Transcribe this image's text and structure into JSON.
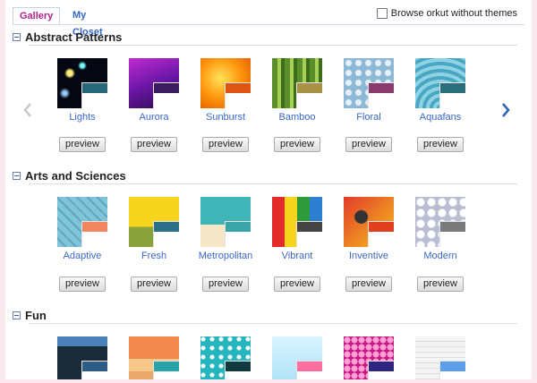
{
  "tabs": [
    {
      "label": "Gallery",
      "active": true
    },
    {
      "label": "My Closet",
      "active": false
    }
  ],
  "browse_option": {
    "label": "Browse orkut without themes",
    "checked": false
  },
  "preview_label": "preview",
  "sections": [
    {
      "title": "Abstract Patterns",
      "items": [
        {
          "name": "Lights",
          "art": "t-lights",
          "swatch": "#27677a"
        },
        {
          "name": "Aurora",
          "art": "t-aurora",
          "swatch": "#3a1d5e"
        },
        {
          "name": "Sunburst",
          "art": "t-sunburst",
          "swatch": "#dd5513"
        },
        {
          "name": "Bamboo",
          "art": "t-bamboo",
          "swatch": "#a89144"
        },
        {
          "name": "Floral",
          "art": "t-floral",
          "swatch": "#8b3a6c"
        },
        {
          "name": "Aquafans",
          "art": "t-aquafans",
          "swatch": "#2c6f7c"
        }
      ]
    },
    {
      "title": "Arts and Sciences",
      "items": [
        {
          "name": "Adaptive",
          "art": "t-adaptive",
          "swatch": "#f2875f"
        },
        {
          "name": "Fresh",
          "art": "t-fresh",
          "swatch": "#2d6f86"
        },
        {
          "name": "Metropolitan",
          "art": "t-metro",
          "swatch": "#3aa5a8"
        },
        {
          "name": "Vibrant",
          "art": "t-vibrant",
          "swatch": "#444444"
        },
        {
          "name": "Inventive",
          "art": "t-inventive",
          "swatch": "#e04020"
        },
        {
          "name": "Modern",
          "art": "t-modern",
          "swatch": "#7a7a7a"
        }
      ]
    },
    {
      "title": "Fun",
      "items": [
        {
          "name": "",
          "art": "t-fun1",
          "swatch": "#2d5d86"
        },
        {
          "name": "",
          "art": "t-fun2",
          "swatch": "#29a5a8"
        },
        {
          "name": "",
          "art": "t-fun3",
          "swatch": "#123a3e"
        },
        {
          "name": "",
          "art": "t-fun4",
          "swatch": "#ff6f9f"
        },
        {
          "name": "",
          "art": "t-fun5",
          "swatch": "#2f2580"
        },
        {
          "name": "",
          "art": "t-fun6",
          "swatch": "#5d9ee8"
        }
      ]
    }
  ],
  "colors": {
    "accent_tab": "#b0218f",
    "link": "#3a66c8",
    "page_bg": "#fbe9ef"
  }
}
